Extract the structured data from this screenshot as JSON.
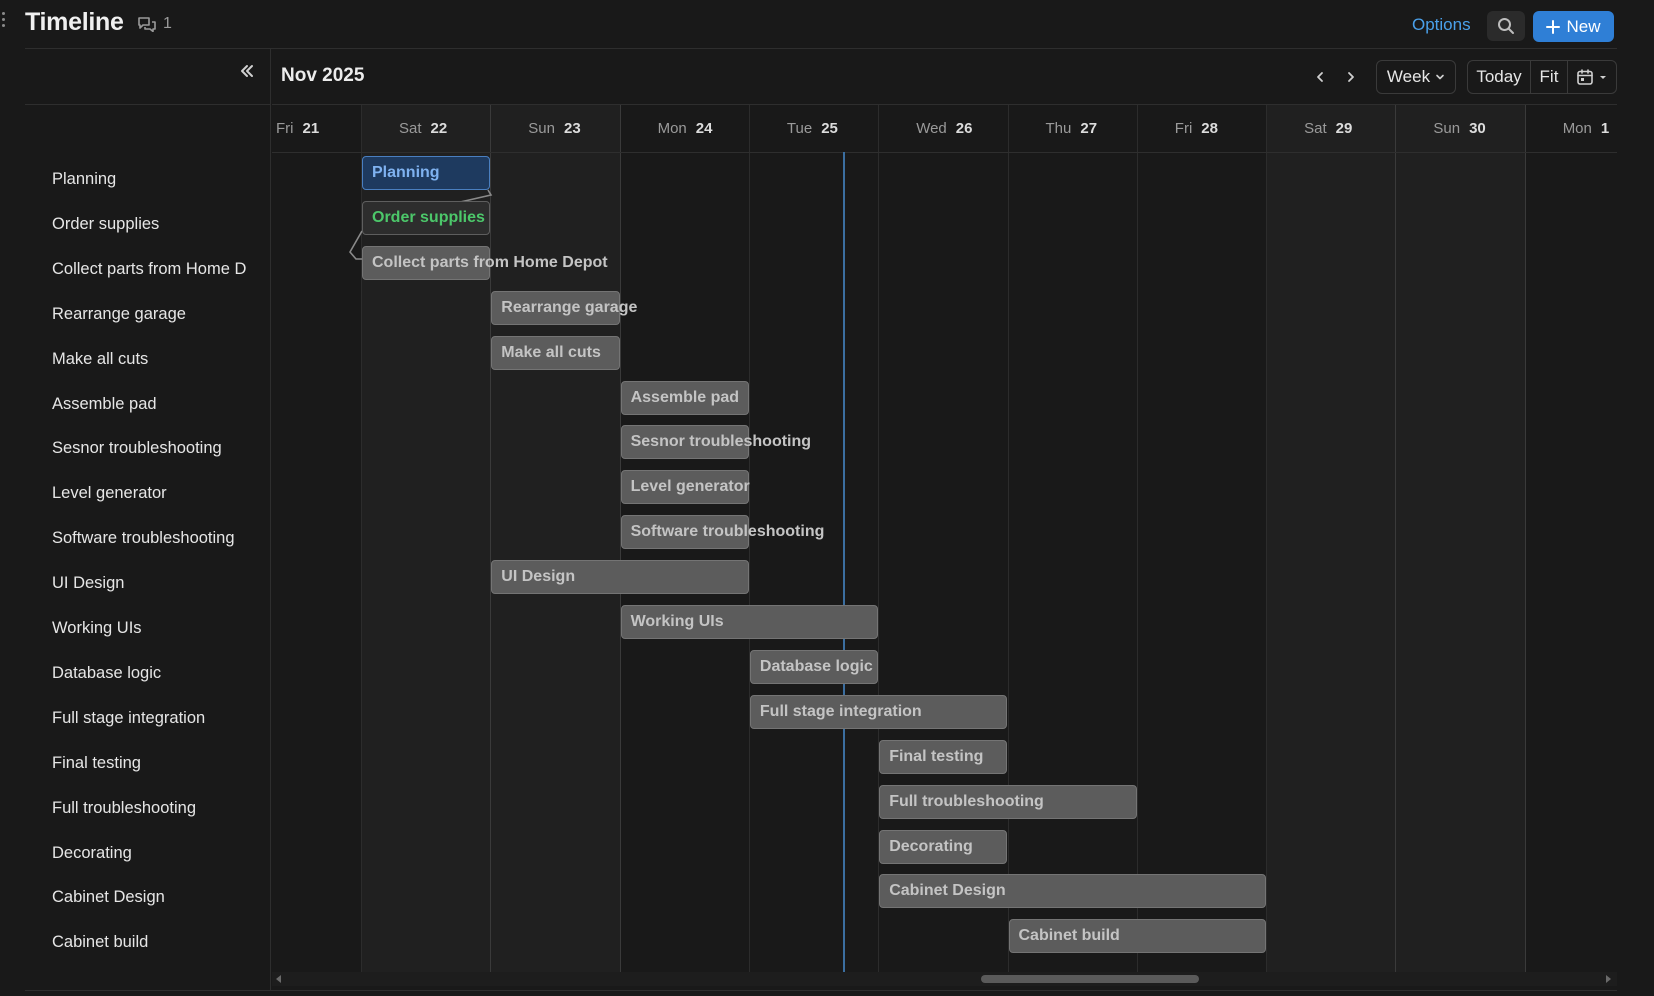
{
  "header": {
    "title": "Timeline",
    "comment_count": "1",
    "options_label": "Options",
    "new_label": "New"
  },
  "toolbar": {
    "month": "Nov 2025",
    "view_label": "Week",
    "today_label": "Today",
    "fit_label": "Fit"
  },
  "days": [
    {
      "dow": "Fri",
      "num": "21"
    },
    {
      "dow": "Sat",
      "num": "22"
    },
    {
      "dow": "Sun",
      "num": "23"
    },
    {
      "dow": "Mon",
      "num": "24"
    },
    {
      "dow": "Tue",
      "num": "25"
    },
    {
      "dow": "Wed",
      "num": "26"
    },
    {
      "dow": "Thu",
      "num": "27"
    },
    {
      "dow": "Fri",
      "num": "28"
    },
    {
      "dow": "Sat",
      "num": "29"
    },
    {
      "dow": "Sun",
      "num": "30"
    },
    {
      "dow": "Mon",
      "num": "1"
    }
  ],
  "tasks": [
    {
      "label": "Planning",
      "bar_text": "Planning",
      "start": "Sat 22",
      "end": "Sat 22"
    },
    {
      "label": "Order supplies",
      "bar_text": "Order supplies",
      "start": "Sat 22",
      "end": "Sat 22"
    },
    {
      "label": "Collect parts from Home D",
      "bar_text": "Collect parts from Home Depot",
      "start": "Sat 22",
      "end": "Sat 22"
    },
    {
      "label": "Rearrange garage",
      "bar_text": "Rearrange garage",
      "start": "Sun 23",
      "end": "Sun 23"
    },
    {
      "label": "Make all cuts",
      "bar_text": "Make all cuts",
      "start": "Sun 23",
      "end": "Sun 23"
    },
    {
      "label": "Assemble pad",
      "bar_text": "Assemble pad",
      "start": "Mon 24",
      "end": "Mon 24"
    },
    {
      "label": "Sesnor troubleshooting",
      "bar_text": "Sesnor troubleshooting",
      "start": "Mon 24",
      "end": "Mon 24"
    },
    {
      "label": "Level generator",
      "bar_text": "Level generator",
      "start": "Mon 24",
      "end": "Mon 24"
    },
    {
      "label": "Software troubleshooting",
      "bar_text": "Software troubleshooting",
      "start": "Mon 24",
      "end": "Mon 24"
    },
    {
      "label": "UI Design",
      "bar_text": "UI Design",
      "start": "Sun 23",
      "end": "Mon 24"
    },
    {
      "label": "Working UIs",
      "bar_text": "Working UIs",
      "start": "Mon 24",
      "end": "Tue 25"
    },
    {
      "label": "Database logic",
      "bar_text": "Database logic",
      "start": "Tue 25",
      "end": "Tue 25"
    },
    {
      "label": "Full stage integration",
      "bar_text": "Full stage integration",
      "start": "Tue 25",
      "end": "Wed 26"
    },
    {
      "label": "Final testing",
      "bar_text": "Final testing",
      "start": "Wed 26",
      "end": "Wed 26"
    },
    {
      "label": "Full troubleshooting",
      "bar_text": "Full troubleshooting",
      "start": "Wed 26",
      "end": "Thu 27"
    },
    {
      "label": "Decorating",
      "bar_text": "Decorating",
      "start": "Wed 26",
      "end": "Wed 26"
    },
    {
      "label": "Cabinet Design",
      "bar_text": "Cabinet Design",
      "start": "Wed 26",
      "end": "Fri 28"
    },
    {
      "label": "Cabinet build",
      "bar_text": "Cabinet build",
      "start": "Thu 27",
      "end": "Fri 28"
    }
  ],
  "colors": {
    "accent": "#2f7fd6",
    "link": "#4aa0ea",
    "planning_text": "#7fb2f0",
    "supplies_text": "#4cc76a",
    "today_line": "#3b6ea0"
  },
  "icons": {
    "drag": "drag-handle-icon",
    "comment": "comment-icon",
    "search": "search-icon",
    "new": "plus-icon",
    "collapse": "double-chevron-left-icon",
    "prev": "chevron-left-icon",
    "next": "chevron-right-icon",
    "view_dropdown": "chevron-down-icon",
    "calendar": "calendar-icon"
  }
}
